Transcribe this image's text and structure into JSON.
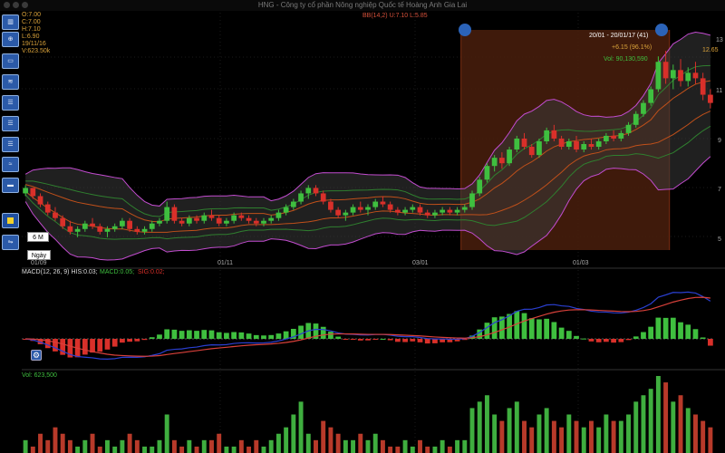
{
  "window": {
    "title": "HNG - Công ty cổ phần Nông nghiệp Quốc tế Hoàng Anh Gia Lai"
  },
  "ohlc": {
    "open": "O:7.00",
    "close": "C:7.00",
    "high": "H:7.10",
    "low": "L:6.90",
    "date": "19/11/16",
    "volume": "V:623.50k"
  },
  "indicator_header": {
    "bb": "BB(14,2) U:7.10   L:5.85"
  },
  "toolbar": {
    "buttons": [
      "chart-type",
      "crosshair",
      "zoom",
      "indicator-panel-1",
      "indicator-panel-2",
      "indicator-panel-3",
      "indicator-panel-4",
      "indicator-panel-5",
      "indicator-panel-6",
      "drawing-tool",
      "layout"
    ]
  },
  "selection": {
    "range": "20/01 - 20/01/17 (41)",
    "change": "+6.15 (96.1%)",
    "volume": "Vol: 90,130,590"
  },
  "price_axis": {
    "labels": [
      "13",
      "12.65",
      "11",
      "9",
      "7",
      "5"
    ]
  },
  "time_axis": {
    "labels": [
      "01/11",
      "03/01",
      "01/03"
    ],
    "start": "01/09"
  },
  "controls": {
    "period": "6 M",
    "interval": "Ngày"
  },
  "macd": {
    "label": "MACD(12, 26, 9) HIS:0.03;",
    "macd_value": "MACD:0.05;",
    "sig_value": "SIG:0.02;"
  },
  "volume_panel": {
    "label": "Vol: 623,500"
  },
  "colors": {
    "up": "#3fbf3f",
    "down": "#d9302a",
    "bb_band": "#c24ccf",
    "selection": "#4a1e0d",
    "macd_line": "#2a3fd0",
    "signal_line": "#d8403a"
  },
  "chart_data": {
    "type": "candlestick",
    "ylim": [
      5,
      13
    ],
    "candles": [
      [
        7.2,
        7.5,
        7.1,
        7.4
      ],
      [
        7.4,
        7.4,
        7.0,
        7.1
      ],
      [
        7.1,
        7.2,
        6.7,
        6.8
      ],
      [
        6.8,
        6.9,
        6.4,
        6.5
      ],
      [
        6.5,
        6.7,
        6.2,
        6.3
      ],
      [
        6.3,
        6.4,
        5.9,
        6.0
      ],
      [
        6.0,
        6.2,
        5.7,
        5.8
      ],
      [
        5.8,
        6.0,
        5.6,
        5.9
      ],
      [
        5.9,
        6.2,
        5.8,
        6.1
      ],
      [
        6.1,
        6.3,
        5.9,
        6.0
      ],
      [
        6.0,
        6.1,
        5.7,
        5.8
      ],
      [
        5.8,
        6.0,
        5.6,
        5.9
      ],
      [
        5.9,
        6.1,
        5.8,
        6.0
      ],
      [
        6.0,
        6.3,
        5.9,
        6.2
      ],
      [
        6.2,
        6.3,
        5.8,
        5.9
      ],
      [
        5.9,
        6.0,
        5.7,
        5.8
      ],
      [
        5.8,
        6.0,
        5.7,
        5.9
      ],
      [
        5.9,
        6.2,
        5.8,
        6.1
      ],
      [
        6.1,
        6.3,
        6.0,
        6.2
      ],
      [
        6.2,
        6.9,
        6.1,
        6.7
      ],
      [
        6.7,
        6.8,
        6.1,
        6.2
      ],
      [
        6.2,
        6.3,
        6.0,
        6.1
      ],
      [
        6.1,
        6.4,
        6.0,
        6.3
      ],
      [
        6.3,
        6.4,
        6.1,
        6.2
      ],
      [
        6.2,
        6.5,
        6.1,
        6.4
      ],
      [
        6.4,
        6.6,
        6.2,
        6.3
      ],
      [
        6.3,
        6.4,
        6.0,
        6.1
      ],
      [
        6.1,
        6.3,
        6.0,
        6.2
      ],
      [
        6.2,
        6.5,
        6.1,
        6.4
      ],
      [
        6.4,
        6.5,
        6.2,
        6.3
      ],
      [
        6.3,
        6.4,
        6.1,
        6.2
      ],
      [
        6.2,
        6.3,
        6.0,
        6.1
      ],
      [
        6.1,
        6.3,
        6.0,
        6.2
      ],
      [
        6.2,
        6.4,
        6.1,
        6.3
      ],
      [
        6.3,
        6.6,
        6.2,
        6.5
      ],
      [
        6.5,
        6.8,
        6.4,
        6.7
      ],
      [
        6.7,
        7.0,
        6.6,
        6.9
      ],
      [
        6.9,
        7.3,
        6.8,
        7.2
      ],
      [
        7.2,
        7.5,
        7.0,
        7.4
      ],
      [
        7.4,
        7.5,
        7.1,
        7.2
      ],
      [
        7.2,
        7.3,
        6.8,
        6.9
      ],
      [
        6.9,
        7.0,
        6.5,
        6.6
      ],
      [
        6.6,
        6.7,
        6.3,
        6.4
      ],
      [
        6.4,
        6.6,
        6.2,
        6.5
      ],
      [
        6.5,
        6.8,
        6.4,
        6.7
      ],
      [
        6.7,
        6.9,
        6.5,
        6.6
      ],
      [
        6.6,
        6.8,
        6.4,
        6.7
      ],
      [
        6.7,
        7.0,
        6.6,
        6.9
      ],
      [
        6.9,
        7.1,
        6.7,
        6.8
      ],
      [
        6.8,
        6.9,
        6.5,
        6.6
      ],
      [
        6.6,
        6.7,
        6.4,
        6.5
      ],
      [
        6.5,
        6.7,
        6.4,
        6.6
      ],
      [
        6.6,
        6.8,
        6.5,
        6.7
      ],
      [
        6.7,
        6.8,
        6.4,
        6.5
      ],
      [
        6.5,
        6.6,
        6.3,
        6.4
      ],
      [
        6.4,
        6.6,
        6.3,
        6.5
      ],
      [
        6.5,
        6.7,
        6.4,
        6.6
      ],
      [
        6.6,
        6.7,
        6.4,
        6.5
      ],
      [
        6.5,
        6.7,
        6.4,
        6.6
      ],
      [
        6.6,
        6.8,
        6.5,
        6.7
      ],
      [
        6.7,
        7.3,
        6.6,
        7.2
      ],
      [
        7.2,
        7.8,
        7.1,
        7.7
      ],
      [
        7.7,
        8.3,
        7.6,
        8.2
      ],
      [
        8.2,
        8.6,
        8.0,
        8.5
      ],
      [
        8.5,
        8.7,
        8.1,
        8.3
      ],
      [
        8.3,
        8.9,
        8.2,
        8.8
      ],
      [
        8.8,
        9.3,
        8.7,
        9.2
      ],
      [
        9.2,
        9.4,
        8.8,
        8.9
      ],
      [
        8.9,
        9.0,
        8.5,
        8.6
      ],
      [
        8.6,
        9.2,
        8.5,
        9.1
      ],
      [
        9.1,
        9.6,
        9.0,
        9.5
      ],
      [
        9.5,
        9.7,
        9.1,
        9.2
      ],
      [
        9.2,
        9.3,
        8.8,
        8.9
      ],
      [
        8.9,
        9.2,
        8.8,
        9.1
      ],
      [
        9.1,
        9.3,
        8.7,
        8.8
      ],
      [
        8.8,
        9.1,
        8.7,
        9.0
      ],
      [
        9.0,
        9.2,
        8.8,
        8.9
      ],
      [
        8.9,
        9.2,
        8.8,
        9.1
      ],
      [
        9.1,
        9.4,
        9.0,
        9.3
      ],
      [
        9.3,
        9.5,
        9.1,
        9.2
      ],
      [
        9.2,
        9.5,
        9.1,
        9.4
      ],
      [
        9.4,
        9.8,
        9.3,
        9.7
      ],
      [
        9.7,
        10.2,
        9.6,
        10.1
      ],
      [
        10.1,
        10.6,
        10.0,
        10.5
      ],
      [
        10.5,
        11.1,
        10.4,
        11.0
      ],
      [
        11.0,
        12.2,
        10.9,
        12.0
      ],
      [
        12.0,
        12.4,
        11.2,
        11.4
      ],
      [
        11.4,
        11.9,
        11.0,
        11.7
      ],
      [
        11.7,
        12.1,
        11.1,
        11.3
      ],
      [
        11.3,
        11.8,
        11.1,
        11.6
      ],
      [
        11.6,
        12.0,
        11.2,
        11.4
      ],
      [
        11.4,
        11.6,
        10.6,
        10.8
      ],
      [
        10.8,
        11.0,
        10.3,
        10.5
      ]
    ],
    "macd": {
      "zero": 0
    },
    "volume": [
      2,
      1,
      3,
      2,
      4,
      3,
      2,
      1,
      2,
      3,
      1,
      2,
      1,
      2,
      3,
      2,
      1,
      1,
      2,
      6,
      2,
      1,
      2,
      1,
      2,
      2,
      3,
      1,
      1,
      2,
      1,
      2,
      1,
      2,
      3,
      4,
      6,
      8,
      3,
      2,
      5,
      4,
      3,
      2,
      2,
      3,
      2,
      3,
      2,
      1,
      1,
      2,
      1,
      2,
      1,
      1,
      2,
      1,
      2,
      2,
      7,
      8,
      9,
      6,
      5,
      7,
      8,
      5,
      4,
      6,
      7,
      5,
      4,
      6,
      5,
      4,
      5,
      4,
      6,
      5,
      5,
      6,
      8,
      9,
      10,
      12,
      11,
      8,
      9,
      7,
      6,
      5,
      4
    ]
  }
}
